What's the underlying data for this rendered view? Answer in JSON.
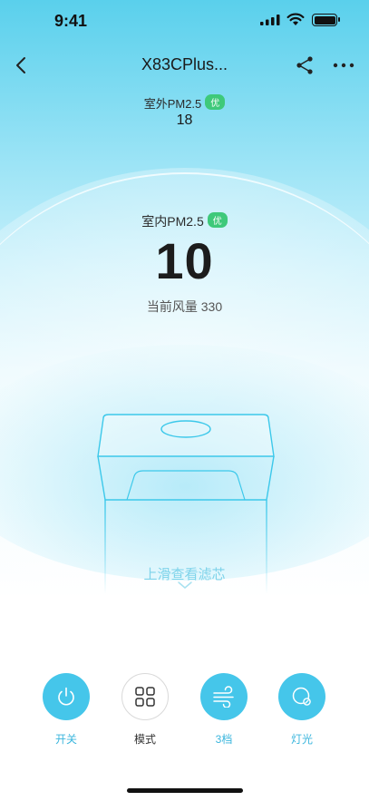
{
  "status_bar": {
    "time": "9:41"
  },
  "nav": {
    "title": "X83CPlus..."
  },
  "outdoor": {
    "label": "室外PM2.5",
    "badge": "优",
    "value": "18"
  },
  "indoor": {
    "label": "室内PM2.5",
    "badge": "优",
    "value": "10"
  },
  "airflow": {
    "text": "当前风量 330"
  },
  "filter_hint": {
    "text": "上滑查看滤芯"
  },
  "controls": [
    {
      "label": "开关",
      "icon": "power-icon",
      "active": true
    },
    {
      "label": "模式",
      "icon": "grid-icon",
      "active": false
    },
    {
      "label": "3档",
      "icon": "wind-icon",
      "active": true
    },
    {
      "label": "灯光",
      "icon": "light-icon",
      "active": true
    }
  ],
  "colors": {
    "accent": "#45c6ea",
    "badge": "#3ec97a",
    "sky_top": "#5ad0ec"
  }
}
